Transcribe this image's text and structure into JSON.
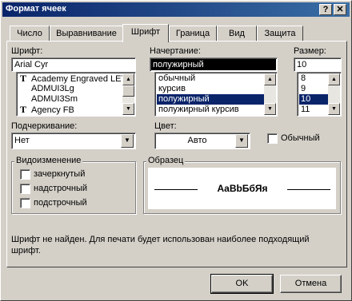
{
  "window": {
    "title": "Формат ячеек",
    "help_label": "?",
    "close_label": "✕"
  },
  "tabs": [
    {
      "label": "Число"
    },
    {
      "label": "Выравнивание"
    },
    {
      "label": "Шрифт"
    },
    {
      "label": "Граница"
    },
    {
      "label": "Вид"
    },
    {
      "label": "Защита"
    }
  ],
  "active_tab": "Шрифт",
  "font": {
    "label": "Шрифт:",
    "value": "Arial Cyr",
    "list": [
      {
        "label": "Academy Engraved LET",
        "icon": "truetype-icon"
      },
      {
        "label": "ADMUI3Lg",
        "icon": ""
      },
      {
        "label": "ADMUI3Sm",
        "icon": ""
      },
      {
        "label": "Agency FB",
        "icon": "truetype-icon"
      }
    ],
    "truetype_glyph": "T"
  },
  "style": {
    "label": "Начертание:",
    "value": "полужирный",
    "list": [
      "обычный",
      "курсив",
      "полужирный",
      "полужирный курсив"
    ],
    "selected": "полужирный"
  },
  "size": {
    "label": "Размер:",
    "value": "10",
    "list": [
      "8",
      "9",
      "10",
      "11"
    ],
    "selected": "10"
  },
  "underline": {
    "label": "Подчеркивание:",
    "value": "Нет"
  },
  "color": {
    "label": "Цвет:",
    "value": "Авто"
  },
  "normal_font": {
    "label": "Обычный",
    "checked": false
  },
  "effects": {
    "title": "Видоизменение",
    "items": [
      {
        "label": "зачеркнутый",
        "checked": false
      },
      {
        "label": "надстрочный",
        "checked": false
      },
      {
        "label": "подстрочный",
        "checked": false
      }
    ]
  },
  "preview": {
    "title": "Образец",
    "sample": "AaBbБбЯя"
  },
  "message": "Шрифт не найден. Для печати будет использован наиболее подходящий шрифт.",
  "buttons": {
    "ok": "OK",
    "cancel": "Отмена"
  },
  "icons": {
    "scroll_up": "▲",
    "scroll_down": "▼",
    "dropdown": "▼"
  },
  "colors": {
    "titlebar_start": "#0a246a",
    "titlebar_end": "#3a6ea5",
    "selection": "#0a246a",
    "face": "#d4d0c8"
  }
}
